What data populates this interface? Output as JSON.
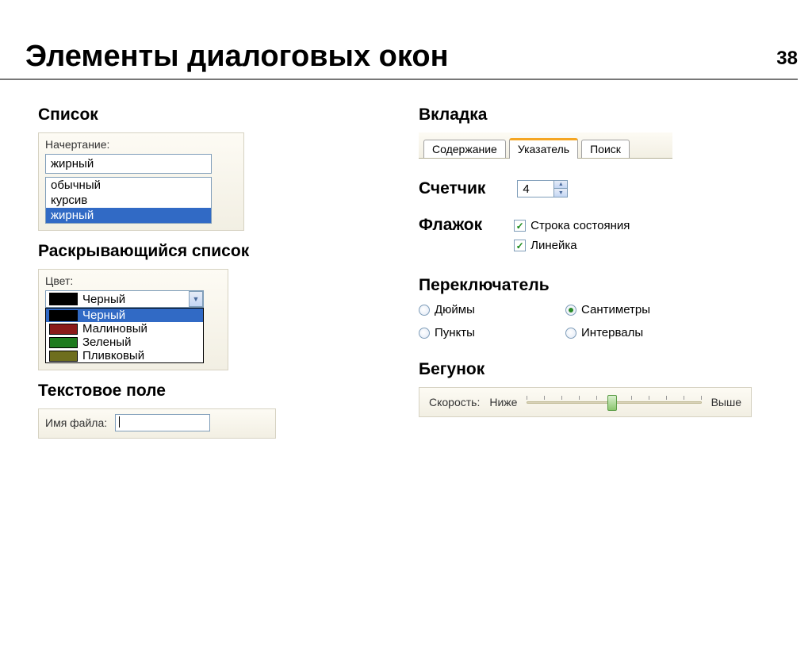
{
  "page_number": "38",
  "title": "Элементы диалоговых окон",
  "list": {
    "heading": "Список",
    "label": "Начертание:",
    "input_value": "жирный",
    "items": [
      "обычный",
      "курсив",
      "жирный"
    ],
    "selected_index": 2
  },
  "dropdown": {
    "heading": "Раскрывающийся список",
    "label": "Цвет:",
    "current": {
      "text": "Черный",
      "color": "#000000"
    },
    "options": [
      {
        "text": "Черный",
        "color": "#000000",
        "highlight": true
      },
      {
        "text": "Малиновый",
        "color": "#8b1a1a"
      },
      {
        "text": "Зеленый",
        "color": "#1e7b1e"
      },
      {
        "text": "Пливковый",
        "color": "#6e6e1e"
      }
    ]
  },
  "textfield": {
    "heading": "Текстовое поле",
    "label": "Имя файла:"
  },
  "tabs": {
    "heading": "Вкладка",
    "items": [
      "Содержание",
      "Указатель",
      "Поиск"
    ],
    "active_index": 1
  },
  "spinner": {
    "heading": "Счетчик",
    "value": "4"
  },
  "checkboxes": {
    "heading": "Флажок",
    "items": [
      {
        "label": "Строка состояния",
        "checked": true
      },
      {
        "label": "Линейка",
        "checked": true
      }
    ]
  },
  "radios": {
    "heading": "Переключатель",
    "items": [
      {
        "label": "Дюймы",
        "checked": false
      },
      {
        "label": "Сантиметры",
        "checked": true
      },
      {
        "label": "Пункты",
        "checked": false
      },
      {
        "label": "Интервалы",
        "checked": false
      }
    ]
  },
  "slider": {
    "heading": "Бегунок",
    "label": "Скорость:",
    "low": "Ниже",
    "high": "Выше"
  }
}
